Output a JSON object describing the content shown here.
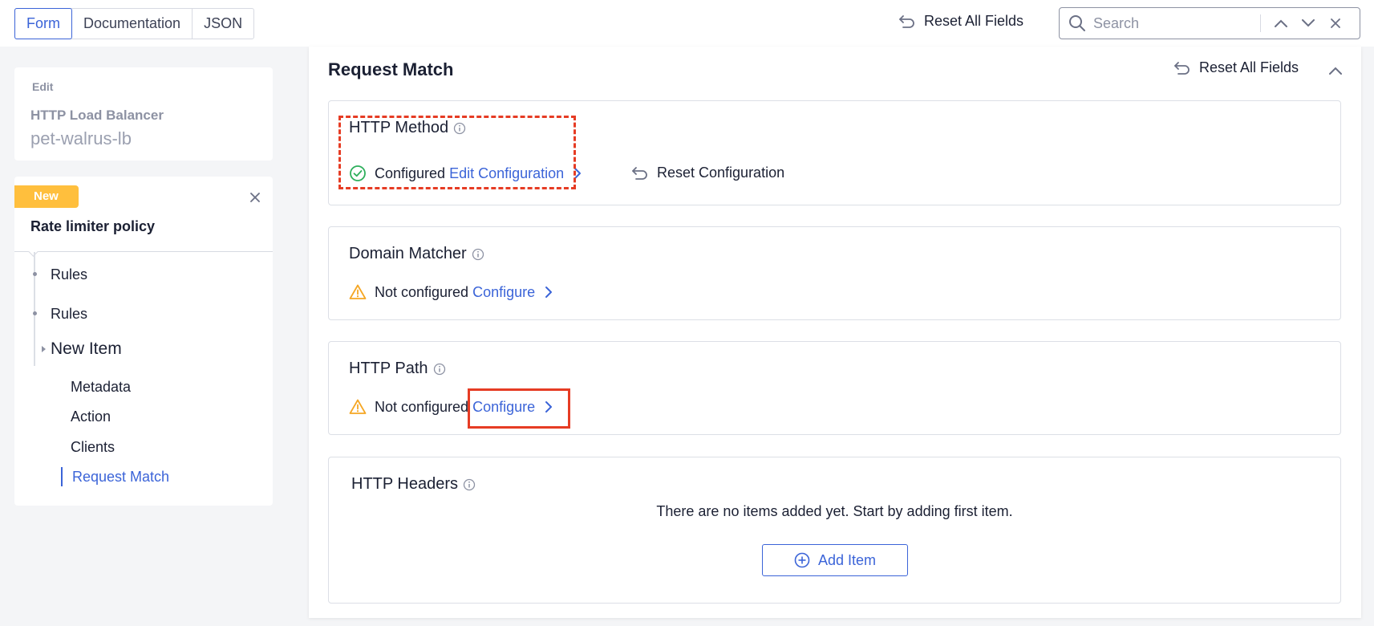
{
  "top_bar": {
    "tabs": [
      "Form",
      "Documentation",
      "JSON"
    ],
    "active_tab": "Form",
    "reset_all_label": "Reset All Fields",
    "search_placeholder": "Search"
  },
  "edit_card": {
    "label": "Edit",
    "type": "HTTP Load Balancer",
    "name": "pet-walrus-lb"
  },
  "nav": {
    "badge": "New",
    "title": "Rate limiter policy",
    "tree": [
      "Rules",
      "Rules",
      "New Item"
    ],
    "sub_items": [
      "Metadata",
      "Action",
      "Clients",
      "Request Match"
    ],
    "active_sub_item": "Request Match"
  },
  "main": {
    "title": "Request Match",
    "reset_all_label": "Reset All Fields",
    "sections": {
      "http_method": {
        "title": "HTTP Method",
        "status": "Configured",
        "action": "Edit Configuration",
        "reset": "Reset Configuration"
      },
      "domain_matcher": {
        "title": "Domain Matcher",
        "status": "Not configured",
        "action": "Configure"
      },
      "http_path": {
        "title": "HTTP Path",
        "status": "Not configured",
        "action": "Configure"
      },
      "http_headers": {
        "title": "HTTP Headers",
        "empty_message": "There are no items added yet. Start by adding first item.",
        "add_label": "Add Item"
      }
    }
  },
  "colors": {
    "accent": "#3b64d8",
    "success": "#2eaf5c",
    "warning": "#f5a623",
    "badge": "#ffbf3d",
    "highlight": "#e63c24"
  }
}
